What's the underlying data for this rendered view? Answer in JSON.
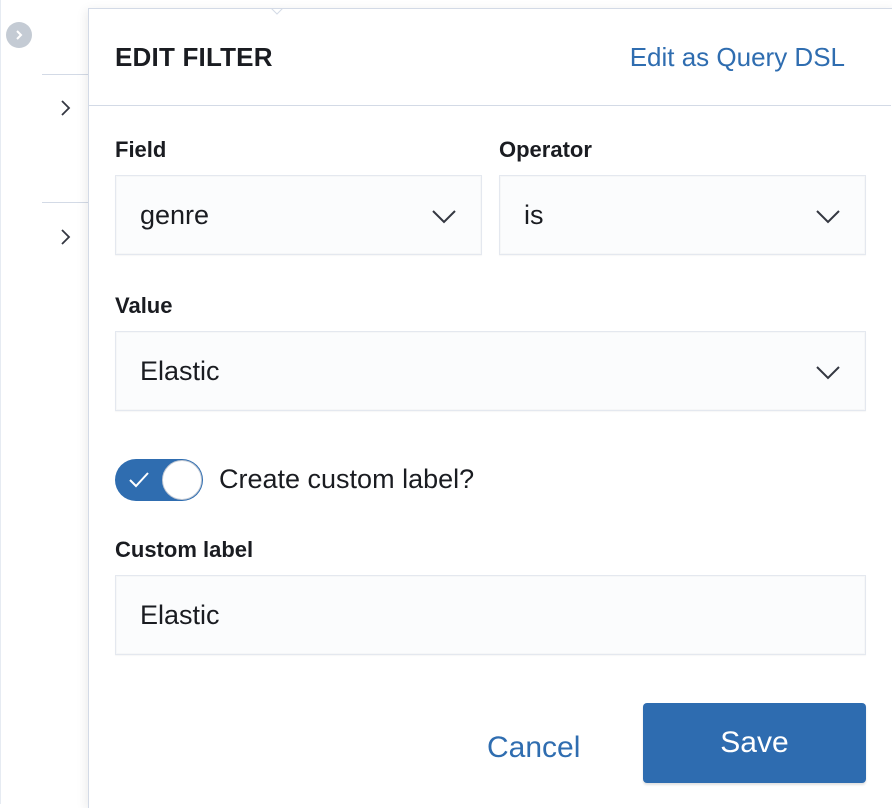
{
  "background": {
    "icons": [
      "collapse-circle-icon",
      "chevron-right-icon",
      "chevron-right-icon"
    ]
  },
  "popover": {
    "title": "EDIT FILTER",
    "dsl_link": "Edit as Query DSL",
    "field": {
      "label": "Field",
      "value": "genre"
    },
    "operator": {
      "label": "Operator",
      "value": "is"
    },
    "value": {
      "label": "Value",
      "value": "Elastic"
    },
    "custom_label_toggle": {
      "label": "Create custom label?",
      "checked": true
    },
    "custom_label": {
      "label": "Custom label",
      "value": "Elastic"
    },
    "actions": {
      "cancel": "Cancel",
      "save": "Save"
    }
  },
  "colors": {
    "accent": "#2f6db0",
    "text": "#1a1c21",
    "border": "#d3dae6",
    "input_bg": "#fbfcfd"
  }
}
